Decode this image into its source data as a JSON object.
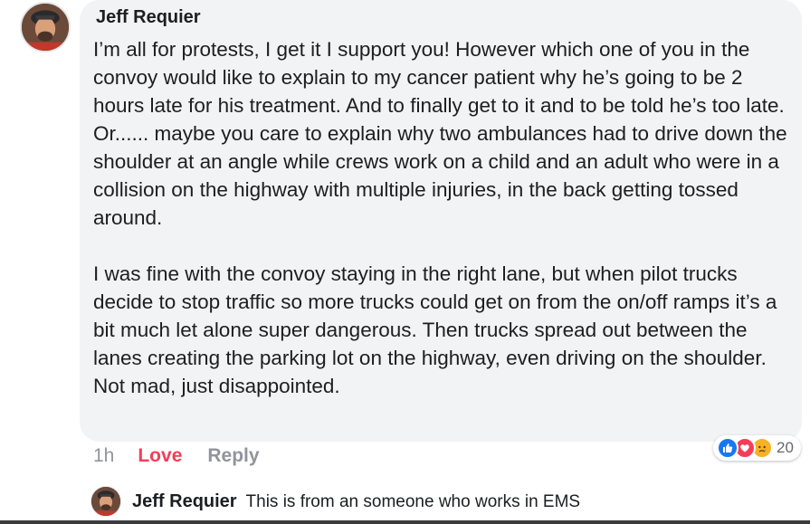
{
  "comment": {
    "author": "Jeff Requier",
    "paragraphs": [
      "I’m all for protests, I get it I support you! However which one of you in the convoy would like to explain to my cancer patient why he’s going to be 2 hours late for his treatment. And to finally get to it and to be told he’s too late.",
      "Or...... maybe you care to explain why two ambulances had to drive down the shoulder at an angle while crews work on a child and an adult who were in a collision on the highway with multiple injuries, in the back getting tossed around.",
      "I was fine with the convoy staying in the right lane, but when pilot trucks decide to stop traffic so more trucks could get on from the on/off ramps it’s a bit much let alone super dangerous.  Then trucks spread out between the lanes creating the parking lot on the highway, even driving on the shoulder. Not mad, just disappointed."
    ],
    "time": "1h",
    "love_label": "Love",
    "reply_label": "Reply",
    "reactions": {
      "icons": [
        "like-icon",
        "love-icon",
        "sad-icon"
      ],
      "count": "20"
    }
  },
  "reply": {
    "author": "Jeff Requier",
    "text": "This is from an someone who works in EMS"
  },
  "colors": {
    "bubble": "#f2f3f5",
    "love": "#f33e58",
    "like": "#1877f2",
    "sad": "#f7b125",
    "meta": "#90949c"
  }
}
